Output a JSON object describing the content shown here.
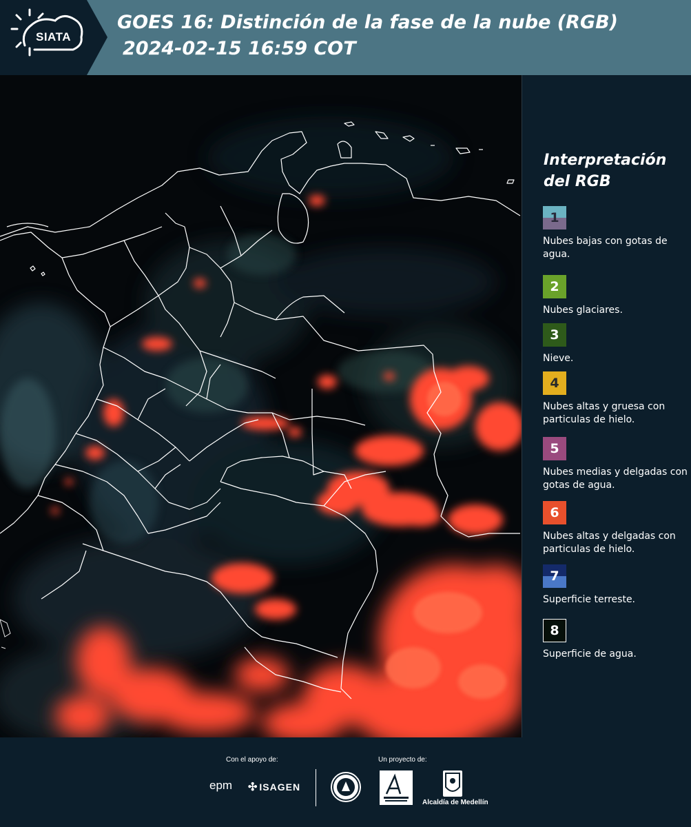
{
  "header": {
    "logo_text": "SIATA",
    "title_line1": "GOES 16: Distinción de la fase de la nube (RGB)",
    "title_line2": "2024-02-15 16:59 COT",
    "colors": {
      "bar": "#4c7584",
      "logo_bg": "#0c1e2b"
    }
  },
  "map": {
    "description_icon": "satellite-rgb-map",
    "background": "#05080b",
    "border_color": "#ffffff",
    "cloud_color": "#ff4a32"
  },
  "legend": {
    "title_line1": "Interpretación",
    "title_line2": "del RGB",
    "items": [
      {
        "number": "1",
        "color_top": "#6bb3c2",
        "color_bottom": "#7a6a8c",
        "text_color": "#2a2a3a",
        "description": "Nubes bajas con gotas de agua."
      },
      {
        "number": "2",
        "color": "#6aa22a",
        "text_color": "#ffffff",
        "description": "Nubes glaciares."
      },
      {
        "number": "3",
        "color": "#2e5a1a",
        "text_color": "#ffffff",
        "description": "Nieve."
      },
      {
        "number": "4",
        "color": "#e3ae1e",
        "text_color": "#2a2a2a",
        "description": "Nubes altas y gruesa con particulas de hielo."
      },
      {
        "number": "5",
        "color": "#9a4a7e",
        "text_color": "#ffffff",
        "description": "Nubes medias y delgadas con gotas de agua."
      },
      {
        "number": "6",
        "color": "#e8502c",
        "text_color": "#ffffff",
        "description": "Nubes altas y delgadas con particulas de hielo."
      },
      {
        "number": "7",
        "color_top": "#142a6a",
        "color_bottom": "#4a78c8",
        "text_color": "#ffffff",
        "description": "Superficie terreste."
      },
      {
        "number": "8",
        "color": "#06100a",
        "text_color": "#ffffff",
        "border": "#ffffff",
        "description": "Superficie de agua."
      }
    ]
  },
  "footer": {
    "support_label": "Con el apoyo de:",
    "project_label": "Un proyecto de:",
    "epm": "epm",
    "isagen": "ISAGEN",
    "alcaldia": "Alcaldía de Medellín"
  }
}
